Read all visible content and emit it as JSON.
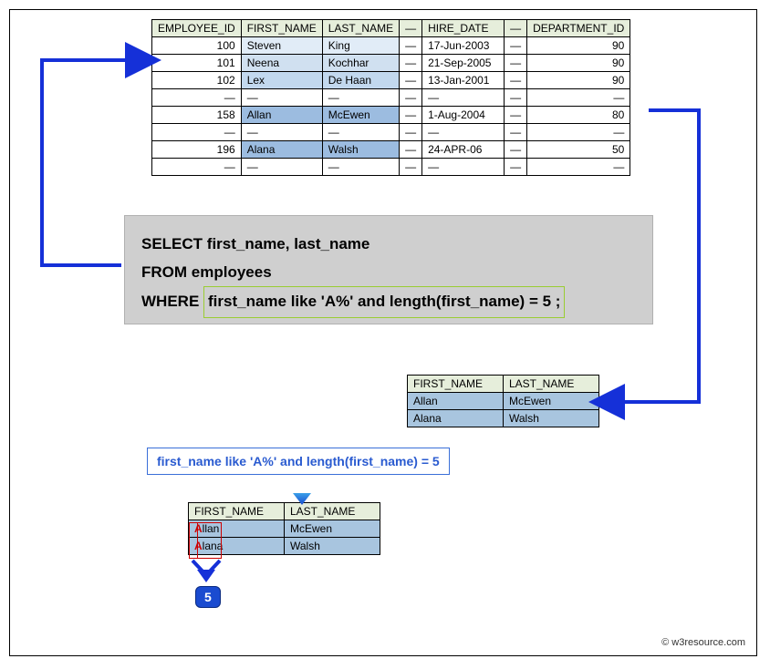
{
  "employees_table": {
    "headers": [
      "EMPLOYEE_ID",
      "FIRST_NAME",
      "LAST_NAME",
      "—",
      "HIRE_DATE",
      "—",
      "DEPARTMENT_ID"
    ],
    "rows": [
      {
        "id": "100",
        "fn": "Steven",
        "ln": "King",
        "date": "17-Jun-2003",
        "dept": "90",
        "css": "row100"
      },
      {
        "id": "101",
        "fn": "Neena",
        "ln": "Kochhar",
        "date": "21-Sep-2005",
        "dept": "90",
        "css": "row101"
      },
      {
        "id": "102",
        "fn": "Lex",
        "ln": "De Haan",
        "date": "13-Jan-2001",
        "dept": "90",
        "css": "row102"
      },
      {
        "id": "—",
        "fn": "—",
        "ln": "—",
        "date": "—",
        "dept": "—",
        "css": "rowdash"
      },
      {
        "id": "158",
        "fn": "Allan",
        "ln": "McEwen",
        "date": "1-Aug-2004",
        "dept": "80",
        "css": "row158"
      },
      {
        "id": "—",
        "fn": "—",
        "ln": "—",
        "date": "—",
        "dept": "—",
        "css": "rowdash"
      },
      {
        "id": "196",
        "fn": "Alana",
        "ln": "Walsh",
        "date": "24-APR-06",
        "dept": "50",
        "css": "row196"
      },
      {
        "id": "—",
        "fn": "—",
        "ln": "—",
        "date": "—",
        "dept": "—",
        "css": "rowdash"
      }
    ]
  },
  "sql": {
    "line1": "SELECT  first_name, last_name",
    "line2": "FROM employees",
    "line3_prefix": "WHERE ",
    "line3_cond": "first_name like 'A%' and length(first_name) = 5 ;"
  },
  "result_headers": [
    "FIRST_NAME",
    "LAST_NAME"
  ],
  "result_rows": [
    {
      "fn": "Allan",
      "ln": "McEwen"
    },
    {
      "fn": "Alana",
      "ln": "Walsh"
    }
  ],
  "condition_text": "first_name like 'A%' and length(first_name) = 5",
  "badge": "5",
  "attribution": "w3resource.com",
  "copyright": "©"
}
